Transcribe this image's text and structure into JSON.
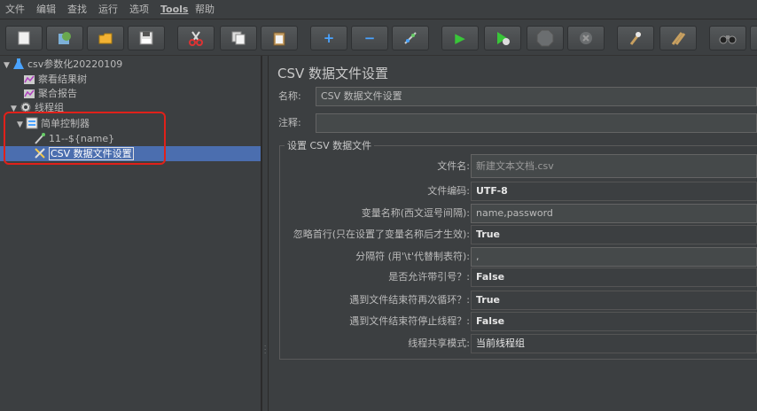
{
  "menu": [
    "文件",
    "编辑",
    "查找",
    "运行",
    "选项",
    "Tools",
    "帮助"
  ],
  "toolbar": {
    "new": "new-icon",
    "templates": "templates-icon",
    "open": "open-icon",
    "save": "save-icon",
    "cut": "cut-icon",
    "copy": "copy-icon",
    "paste": "paste-icon",
    "expand": "+",
    "collapse": "−",
    "toggle": "toggle-icon",
    "start": "▶",
    "start_no_pause": "▶",
    "stop": "stop-icon",
    "shutdown": "shutdown-icon",
    "clear": "clear-icon",
    "clear_all": "clear-all-icon",
    "search": "binoculars-icon"
  },
  "tree": {
    "items": [
      {
        "label": "csv参数化20220109",
        "icon": "flask-icon"
      },
      {
        "label": "察看结果树",
        "icon": "chart-icon"
      },
      {
        "label": "聚合报告",
        "icon": "chart-icon"
      },
      {
        "label": "线程组",
        "icon": "gear-icon"
      },
      {
        "label": "简单控制器",
        "icon": "controller-icon"
      },
      {
        "label": "11--${name}",
        "icon": "pipette-icon"
      },
      {
        "label": "CSV 数据文件设置",
        "icon": "scissors-icon"
      }
    ]
  },
  "panel": {
    "title": "CSV 数据文件设置",
    "name_label": "名称:",
    "name_value": "CSV 数据文件设置",
    "comment_label": "注释:",
    "comment_value": "",
    "group_title": "设置 CSV 数据文件",
    "rows": [
      {
        "label": "文件名:",
        "value": "新建文本文档.csv"
      },
      {
        "label": "文件编码:",
        "value": "UTF-8"
      },
      {
        "label": "变量名称(西文逗号间隔):",
        "value": "name,password"
      },
      {
        "label": "忽略首行(只在设置了变量名称后才生效):",
        "value": "True"
      },
      {
        "label": "分隔符 (用'\\t'代替制表符):",
        "value": ","
      },
      {
        "label": "是否允许带引号？:",
        "value": "False"
      },
      {
        "label": "遇到文件结束符再次循环？:",
        "value": "True"
      },
      {
        "label": "遇到文件结束符停止线程？:",
        "value": "False"
      },
      {
        "label": "线程共享模式:",
        "value": "当前线程组"
      }
    ]
  },
  "colors": {
    "background": "#3c3f41",
    "selection": "#4b6eaf",
    "annotation": "#e0211a"
  }
}
